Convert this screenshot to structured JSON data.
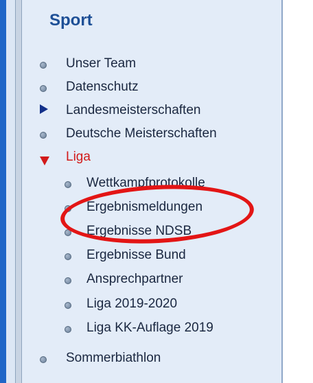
{
  "clip_text": "„, ...",
  "sidebar": {
    "heading": "Sport",
    "items": [
      {
        "label": "Unser Team",
        "marker": "bullet-icon"
      },
      {
        "label": "Datenschutz",
        "marker": "bullet-icon"
      },
      {
        "label": "Landesmeisterschaften",
        "marker": "triangle-right-icon"
      },
      {
        "label": "Deutsche Meisterschaften",
        "marker": "bullet-icon"
      },
      {
        "label": "Liga",
        "marker": "triangle-down-icon",
        "active": true
      },
      {
        "label": "Wettkampfprotokolle",
        "marker": "bullet-icon"
      },
      {
        "label": "Ergebnismeldungen",
        "marker": "bullet-icon"
      },
      {
        "label": "Ergebnisse NDSB",
        "marker": "bullet-icon"
      },
      {
        "label": "Ergebnisse Bund",
        "marker": "bullet-icon"
      },
      {
        "label": "Ansprechpartner",
        "marker": "bullet-icon"
      },
      {
        "label": "Liga 2019-2020",
        "marker": "bullet-icon"
      },
      {
        "label": "Liga KK-Auflage 2019",
        "marker": "bullet-icon"
      },
      {
        "label": "Sommerbiathlon",
        "marker": "bullet-icon"
      }
    ]
  },
  "colors": {
    "heading": "#1d4f96",
    "active_item": "#d21a1a",
    "highlight_ellipse": "#e31515",
    "side_bar": "#1f66c7"
  }
}
